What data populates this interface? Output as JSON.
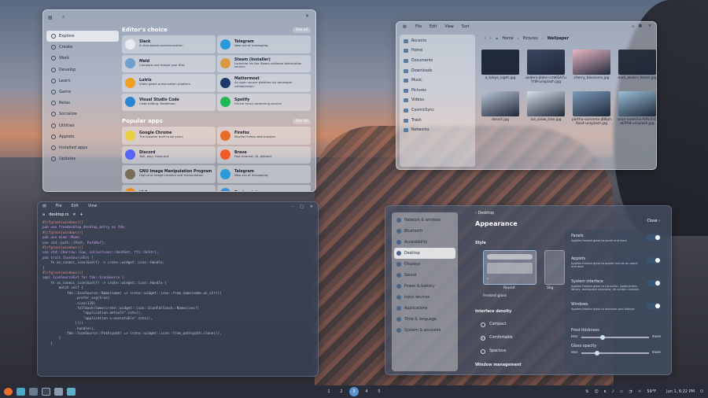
{
  "store": {
    "sidebar": [
      "Explore",
      "Create",
      "Work",
      "Develop",
      "Learn",
      "Game",
      "Relax",
      "Socialize",
      "Utilities",
      "Applets",
      "Installed apps",
      "Updates"
    ],
    "editors_choice": {
      "title": "Editor's choice",
      "see_all": "See all",
      "apps": [
        {
          "name": "Slack",
          "desc": "A chat-based communication",
          "color": "#e8e8ee"
        },
        {
          "name": "Telegram",
          "desc": "New era of messaging",
          "color": "#2a9ad8"
        },
        {
          "name": "Meld",
          "desc": "Compare and merge your files",
          "color": "#6ea0d0"
        },
        {
          "name": "Steam (Installer)",
          "desc": "Launcher for the Steam software distribution service",
          "color": "#d89a40"
        },
        {
          "name": "Lutris",
          "desc": "Video game preservation platform",
          "color": "#f0a020"
        },
        {
          "name": "Mattermost",
          "desc": "An open source platform for developer collaboration",
          "color": "#1e3a6a"
        },
        {
          "name": "Visual Studio Code",
          "desc": "Code editing. Redefined.",
          "color": "#2a86d0"
        },
        {
          "name": "Spotify",
          "desc": "Online music streaming service",
          "color": "#1eb954"
        }
      ]
    },
    "popular": {
      "title": "Popular apps",
      "see_all": "See all",
      "apps": [
        {
          "name": "Google Chrome",
          "desc": "The browser built to be yours",
          "color": "#e8d040"
        },
        {
          "name": "Firefox",
          "desc": "Mozilla Firefox web browser",
          "color": "#e86a2a"
        },
        {
          "name": "Discord",
          "desc": "Talk, play, hang out",
          "color": "#5865f2"
        },
        {
          "name": "Brave",
          "desc": "Fast Internet, AI, Adblock",
          "color": "#f05a28"
        },
        {
          "name": "GNU Image Manipulation Program",
          "desc": "High-end image creation and manipulation",
          "color": "#7a6a5a"
        },
        {
          "name": "Telegram",
          "desc": "New era of messaging",
          "color": "#2a9ad8"
        },
        {
          "name": "VLC",
          "desc": "",
          "color": "#f08a20"
        },
        {
          "name": "Dockerstate",
          "desc": "",
          "color": "#3a90d8"
        }
      ]
    }
  },
  "files": {
    "menu": [
      "File",
      "Edit",
      "View",
      "Sort"
    ],
    "breadcrumb": [
      "Home",
      "Pictures",
      "Wallpaper"
    ],
    "sidebar": [
      "Recents",
      "Home",
      "Documents",
      "Downloads",
      "Music",
      "Pictures",
      "Videos",
      "CosmicSync",
      "Trash",
      "Networks"
    ],
    "items": [
      {
        "name": "a_tokyo_night.jpg",
        "color": "#1e2a3c"
      },
      {
        "name": "anders-jilden-cmKGA7uYrW-unsplash.jpg",
        "color": "#3a4660"
      },
      {
        "name": "cherry_blossoms.jpg",
        "color": "#e8b8c4"
      },
      {
        "name": "dark_winter_forest.jpg",
        "color": "#2a3038"
      },
      {
        "name": "desert.jpg",
        "color": "#b8c4d4"
      },
      {
        "name": "ice_snow_tree.jpg",
        "color": "#d8dee6"
      },
      {
        "name": "partha-samanta-j8l8yh9xo4-unsplash.jpg",
        "color": "#7a9ab8"
      },
      {
        "name": "sean-oulashin-KMn4VEeEPR8-unsplash.jpg",
        "color": "#9ac0d8"
      }
    ]
  },
  "editor": {
    "menu": [
      "File",
      "Edit",
      "View"
    ],
    "tab": "desktop.rs",
    "lines": [
      "#[cfg(not(windows))]",
      "pub use freedesktop_desktop_entry as fde;",
      "#[cfg(not(windows))]",
      "pub use mime::Mime;",
      "use std::path::{Path, PathBuf};",
      "#[cfg(not(windows))]",
      "use std::{borrow::Cow, collections::HashSet, ffi::OsStr};",
      "",
      "pub trait IconSourceExt {",
      "    fn as_cosmic_icon(&self) -> crate::widget::icon::Handle;",
      "}",
      "",
      "#[cfg(not(windows))]",
      "impl IconSourceExt for fde::IconSource {",
      "    fn as_cosmic_icon(&self) -> crate::widget::icon::Handle {",
      "        match self {",
      "            fde::IconSource::Name(name) => crate::widget::icon::from_name(name.as_str())",
      "                .prefer_svg(true)",
      "                .size(128)",
      "                .fallback(Some(crate::widget::icon::IconFallback::Names(vec![",
      "                    \"application-default\".into(),",
      "                    \"application-x-executable\".into(),",
      "                ])))",
      "                .handle(),",
      "            fde::IconSource::Path(path) => crate::widget::icon::from_path(path.clone()),",
      "        }",
      "    }"
    ]
  },
  "settings": {
    "sidebar": [
      "Network & wireless",
      "Bluetooth",
      "Accessibility",
      "Desktop",
      "Displays",
      "Sound",
      "Power & battery",
      "Input devices",
      "Applications",
      "Time & language",
      "System & accounts"
    ],
    "back": "Desktop",
    "title": "Appearance",
    "close": "Close",
    "style_label": "Style",
    "style_opts": [
      "Round",
      "Slig"
    ],
    "frosted_label": "Frosted glass",
    "density_label": "Interface density",
    "density": [
      "Compact",
      "Comfortable",
      "Spacious"
    ],
    "window_mgmt": "Window management",
    "toggles": [
      {
        "title": "Panels",
        "desc": "Applies frosted glass to panel and dock"
      },
      {
        "title": "Applets",
        "desc": "Applies frosted glass to applet menus on panel and dock"
      },
      {
        "title": "System interface",
        "desc": "Applies frosted glass to Launcher, Applications library, workspace overview, on-screen controls"
      },
      {
        "title": "Windows",
        "desc": "Applies frosted glass to windows and dialogs"
      }
    ],
    "frost_thickness": "Frost thickness",
    "glass_opacity": "Glass opacity",
    "less": "less",
    "more": "more"
  },
  "taskbar": {
    "workspaces": [
      "1",
      "2",
      "3",
      "4",
      "5"
    ],
    "active": "3",
    "temp": "59°F",
    "clock": "Jun 1, 6:22 PM"
  }
}
